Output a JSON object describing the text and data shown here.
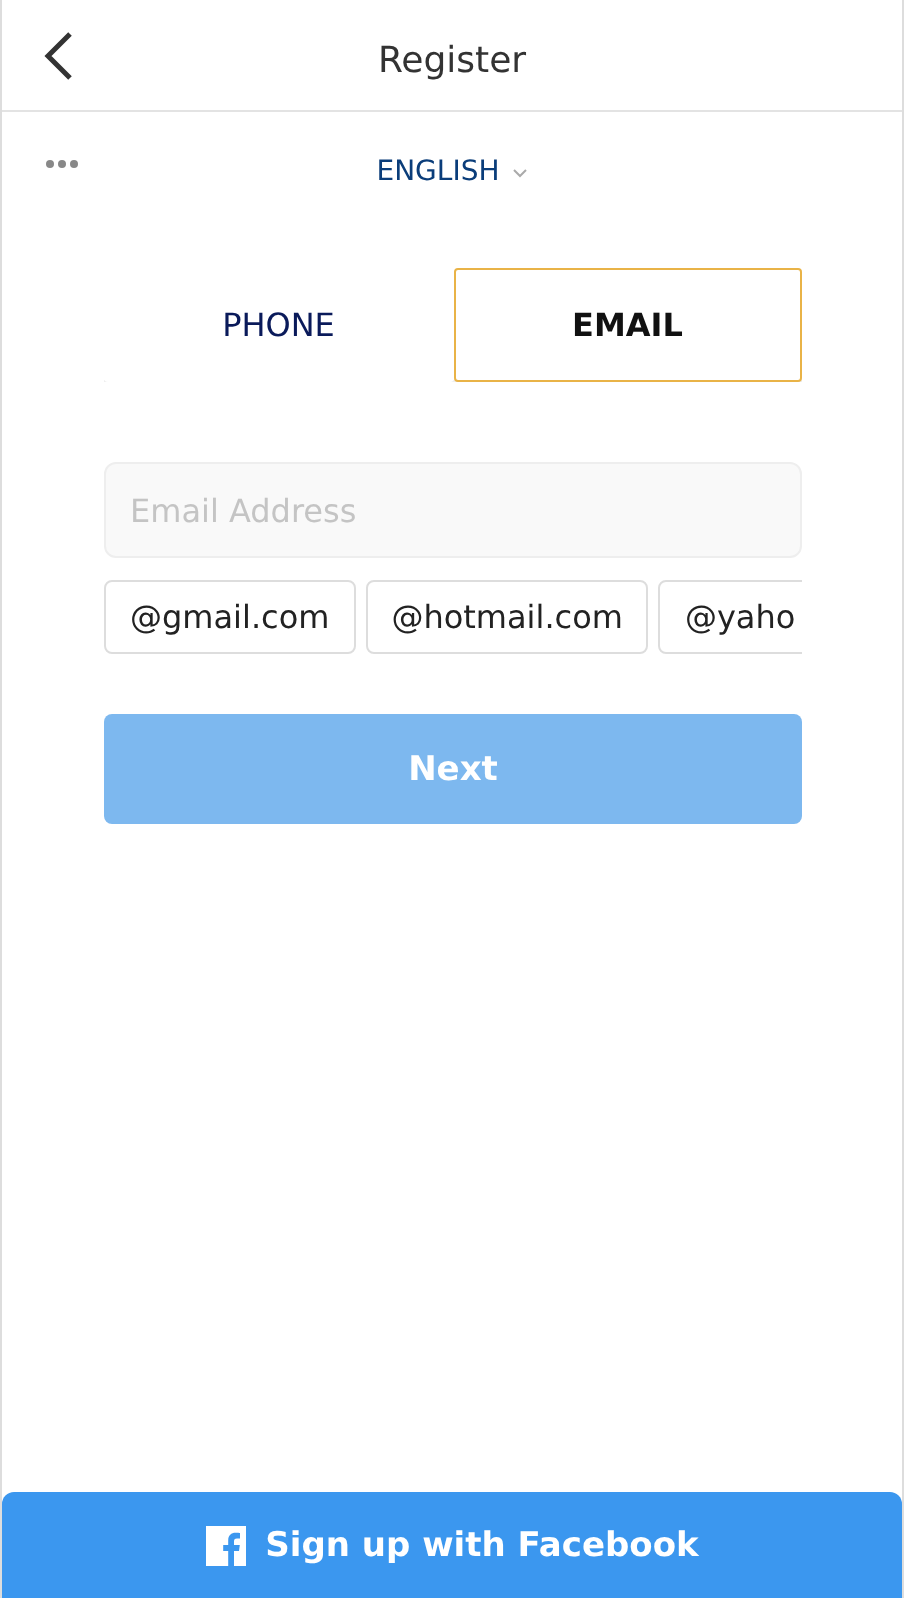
{
  "header": {
    "title": "Register"
  },
  "language": {
    "label": "ENGLISH"
  },
  "tabs": [
    {
      "label": "PHONE",
      "selected": false
    },
    {
      "label": "EMAIL",
      "selected": true
    }
  ],
  "email_field": {
    "placeholder": "Email Address"
  },
  "domain_suggestions": [
    "@gmail.com",
    "@hotmail.com",
    "@yaho"
  ],
  "next_button": {
    "label": "Next",
    "disabled": true
  },
  "facebook_button": {
    "label": "Sign up with Facebook"
  }
}
